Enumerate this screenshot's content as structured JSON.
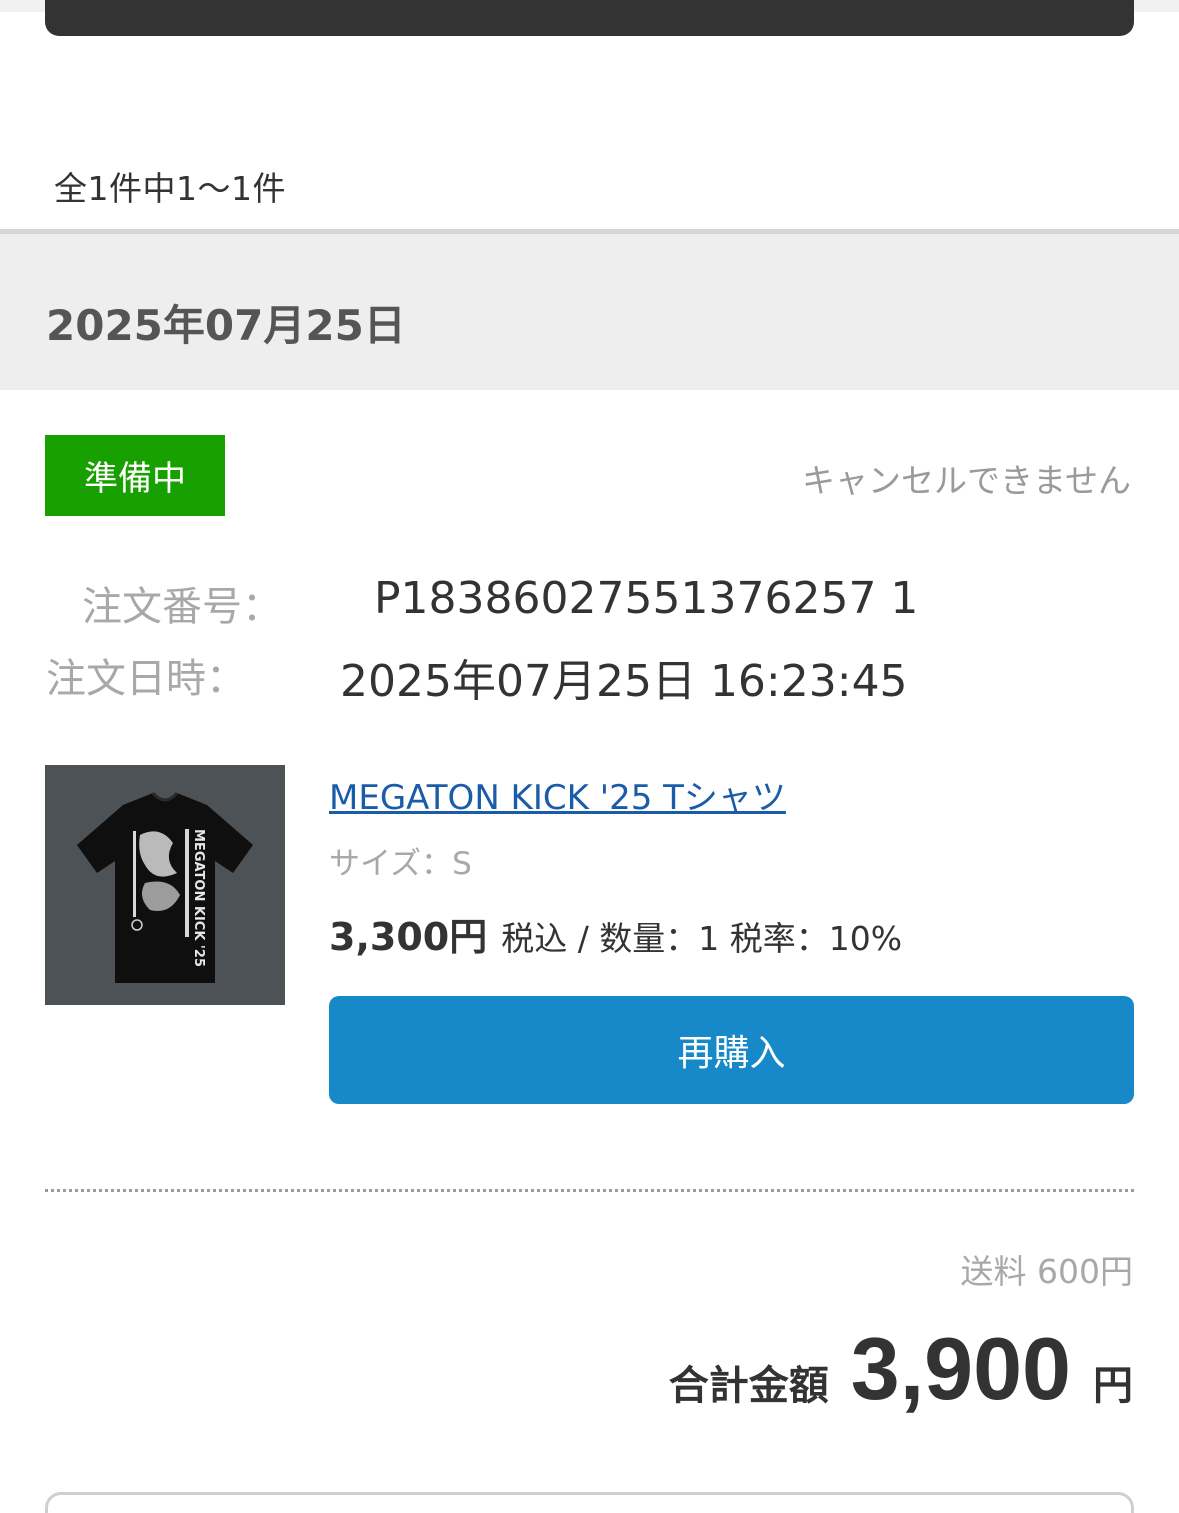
{
  "result_count": "全1件中1〜1件",
  "date_header": "2025年07月25日",
  "order": {
    "status": "準備中",
    "cancel_note": "キャンセルできません",
    "number_label": "注文番号：",
    "number_value": "P18386027551376257 1",
    "datetime_label": "注文日時：",
    "datetime_value": "2025年07月25日 16:23:45"
  },
  "product": {
    "name": "MEGATON KICK '25 Tシャツ",
    "size": "サイズ：S",
    "price": "3,300円",
    "price_meta": "税込 / 数量：1 税率：10%",
    "image_text": "MEGATON KICK '25",
    "rebuy_label": "再購入"
  },
  "summary": {
    "shipping": "送料 600円",
    "total_label": "合計金額",
    "total_amount": "3,900",
    "total_unit": "円"
  },
  "colors": {
    "status_badge": "#17a000",
    "button": "#1788c8",
    "link": "#1a5ca8"
  }
}
